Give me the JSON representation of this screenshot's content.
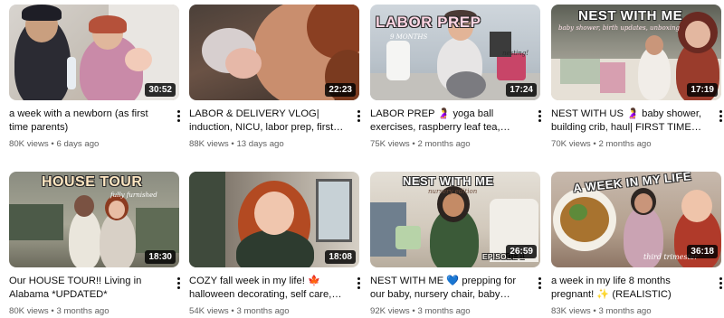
{
  "videos": [
    {
      "title": "a week with a newborn (as first time parents)",
      "views": "80K views",
      "age": "6 days ago",
      "duration": "30:52"
    },
    {
      "title": "LABOR & DELIVERY VLOG| induction, NICU, labor prep, first…",
      "views": "88K views",
      "age": "13 days ago",
      "duration": "22:23"
    },
    {
      "title": "LABOR PREP 🤰 yoga ball exercises, raspberry leaf tea, ultrasound| 9…",
      "views": "75K views",
      "age": "2 months ago",
      "duration": "17:24",
      "overlay": "LABOR PREP",
      "overlay_sub": "9 MONTHS",
      "overlay_tag": "nesting!"
    },
    {
      "title": "NEST WITH US 🤰 baby shower, building crib, haul| FIRST TIME…",
      "views": "70K views",
      "age": "2 months ago",
      "duration": "17:19",
      "overlay": "NEST WITH ME",
      "overlay_sub": "baby shower, birth updates, unboxing"
    },
    {
      "title": "Our HOUSE TOUR!! Living in Alabama *UPDATED*",
      "views": "80K views",
      "age": "3 months ago",
      "duration": "18:30",
      "overlay": "HOUSE TOUR",
      "overlay_sub": "fully furnished"
    },
    {
      "title": "COZY fall week in my life! 🍁 halloween decorating, self care,…",
      "views": "54K views",
      "age": "3 months ago",
      "duration": "18:08"
    },
    {
      "title": "NEST WITH ME 💙 prepping for our baby, nursery chair, baby clothes|…",
      "views": "92K views",
      "age": "3 months ago",
      "duration": "26:59",
      "overlay": "NEST WITH ME",
      "overlay_sub": "nursery edition",
      "overlay_tag": "EPISODE 1"
    },
    {
      "title": "a week in my life 8 months pregnant! ✨ (REALISTIC)",
      "views": "83K views",
      "age": "3 months ago",
      "duration": "36:18",
      "overlay": "A WEEK IN MY LIFE",
      "overlay_sub": "third trimester"
    }
  ],
  "separator": " • ",
  "colors": {
    "text_primary": "#0f0f0f",
    "text_secondary": "#606060",
    "badge_bg": "#000000cc"
  }
}
